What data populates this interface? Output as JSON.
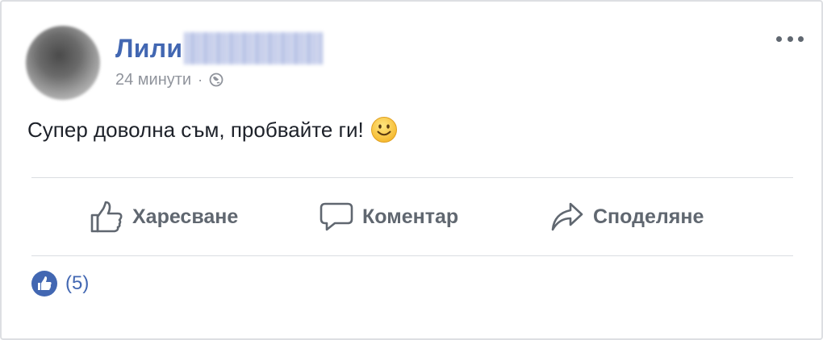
{
  "post": {
    "author_name": "Лили",
    "time": "24 минути",
    "separator": "·",
    "privacy_icon": "globe-icon",
    "text": "Супер доволна съм, пробвайте ги!",
    "emoji": "smiley-emoji"
  },
  "actions": {
    "like_label": "Харесване",
    "comment_label": "Коментар",
    "share_label": "Споделяне"
  },
  "reactions": {
    "icon": "like-icon",
    "count": "(5)"
  },
  "colors": {
    "brand_blue": "#4267b2",
    "secondary_text": "#90949c",
    "action_text": "#606770",
    "border": "#dddfe2"
  }
}
